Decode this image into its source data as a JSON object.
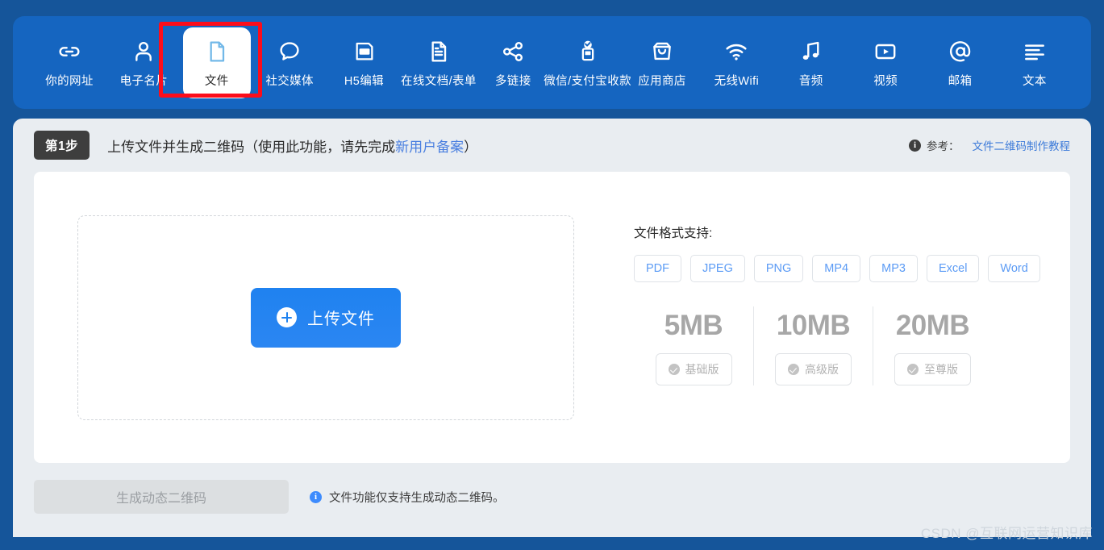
{
  "nav": {
    "items": [
      {
        "label": "你的网址",
        "icon": "link-icon",
        "active": false
      },
      {
        "label": "电子名片",
        "icon": "person-icon",
        "active": false
      },
      {
        "label": "文件",
        "icon": "file-icon",
        "active": true
      },
      {
        "label": "社交媒体",
        "icon": "chat-bubble-icon",
        "active": false
      },
      {
        "label": "H5编辑",
        "icon": "html-icon",
        "active": false
      },
      {
        "label": "在线文档/表单",
        "icon": "document-icon",
        "active": false
      },
      {
        "label": "多链接",
        "icon": "share-icon",
        "active": false
      },
      {
        "label": "微信/支付宝收款",
        "icon": "payment-icon",
        "active": false
      },
      {
        "label": "应用商店",
        "icon": "store-bag-icon",
        "active": false
      },
      {
        "label": "无线Wifi",
        "icon": "wifi-icon",
        "active": false
      },
      {
        "label": "音频",
        "icon": "music-note-icon",
        "active": false
      },
      {
        "label": "视频",
        "icon": "video-play-icon",
        "active": false
      },
      {
        "label": "邮箱",
        "icon": "at-sign-icon",
        "active": false
      },
      {
        "label": "文本",
        "icon": "text-lines-icon",
        "active": false
      }
    ]
  },
  "step": {
    "badge": "第1步",
    "title_before": "上传文件并生成二维码（使用此功能，请先完成",
    "title_link": "新用户备案",
    "title_after": "）",
    "ref_label": "参考：",
    "ref_link": "文件二维码制作教程",
    "info_glyph": "i"
  },
  "upload": {
    "button_label": "上传文件"
  },
  "formats": {
    "title": "文件格式支持:",
    "chips": [
      "PDF",
      "JPEG",
      "PNG",
      "MP4",
      "MP3",
      "Excel",
      "Word"
    ]
  },
  "tiers": [
    {
      "size": "5MB",
      "plan": "基础版"
    },
    {
      "size": "10MB",
      "plan": "高级版"
    },
    {
      "size": "20MB",
      "plan": "至尊版"
    }
  ],
  "footer": {
    "generate_label": "生成动态二维码",
    "note": "文件功能仅支持生成动态二维码。",
    "info_glyph": "i"
  },
  "watermark": "CSDN @互联网运营知识库",
  "colors": {
    "page_bg": "#15559a",
    "nav_bg": "#1565c0",
    "card_bg": "#e9edf1",
    "accent_blue": "#1f82f0",
    "highlight_red": "#fc0d1b",
    "link_blue": "#3d7bd9"
  }
}
